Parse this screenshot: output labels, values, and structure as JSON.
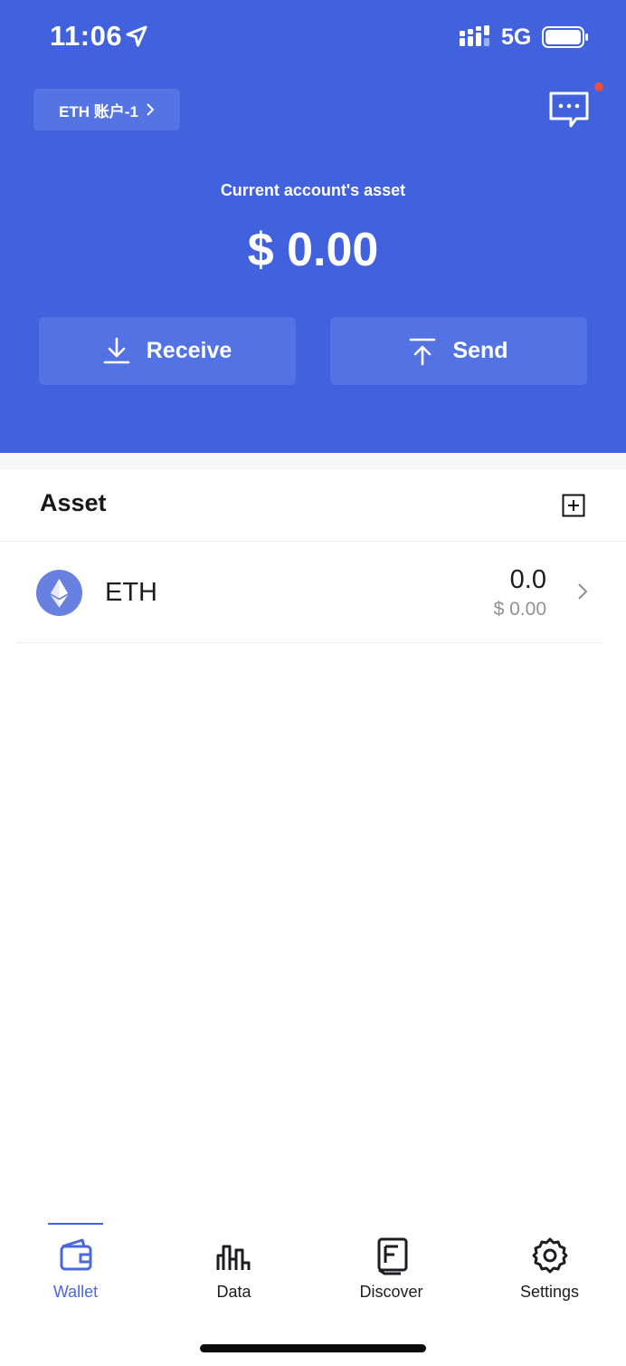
{
  "status_bar": {
    "time": "11:06",
    "network": "5G"
  },
  "header": {
    "account_label": "ETH 账户-1",
    "asset_caption": "Current account's asset",
    "asset_total": "$ 0.00",
    "receive_label": "Receive",
    "send_label": "Send"
  },
  "assets": {
    "title": "Asset",
    "tokens": [
      {
        "name": "ETH",
        "amount": "0.0",
        "value": "$ 0.00",
        "icon": "ethereum-icon"
      }
    ]
  },
  "tabbar": {
    "active": "Wallet",
    "tabs": [
      {
        "label": "Wallet",
        "icon": "wallet-icon"
      },
      {
        "label": "Data",
        "icon": "chart-icon"
      },
      {
        "label": "Discover",
        "icon": "document-icon"
      },
      {
        "label": "Settings",
        "icon": "gear-icon"
      }
    ]
  },
  "colors": {
    "primary": "#4262dd",
    "notification_dot": "#e8513f",
    "muted_text": "#909299"
  }
}
